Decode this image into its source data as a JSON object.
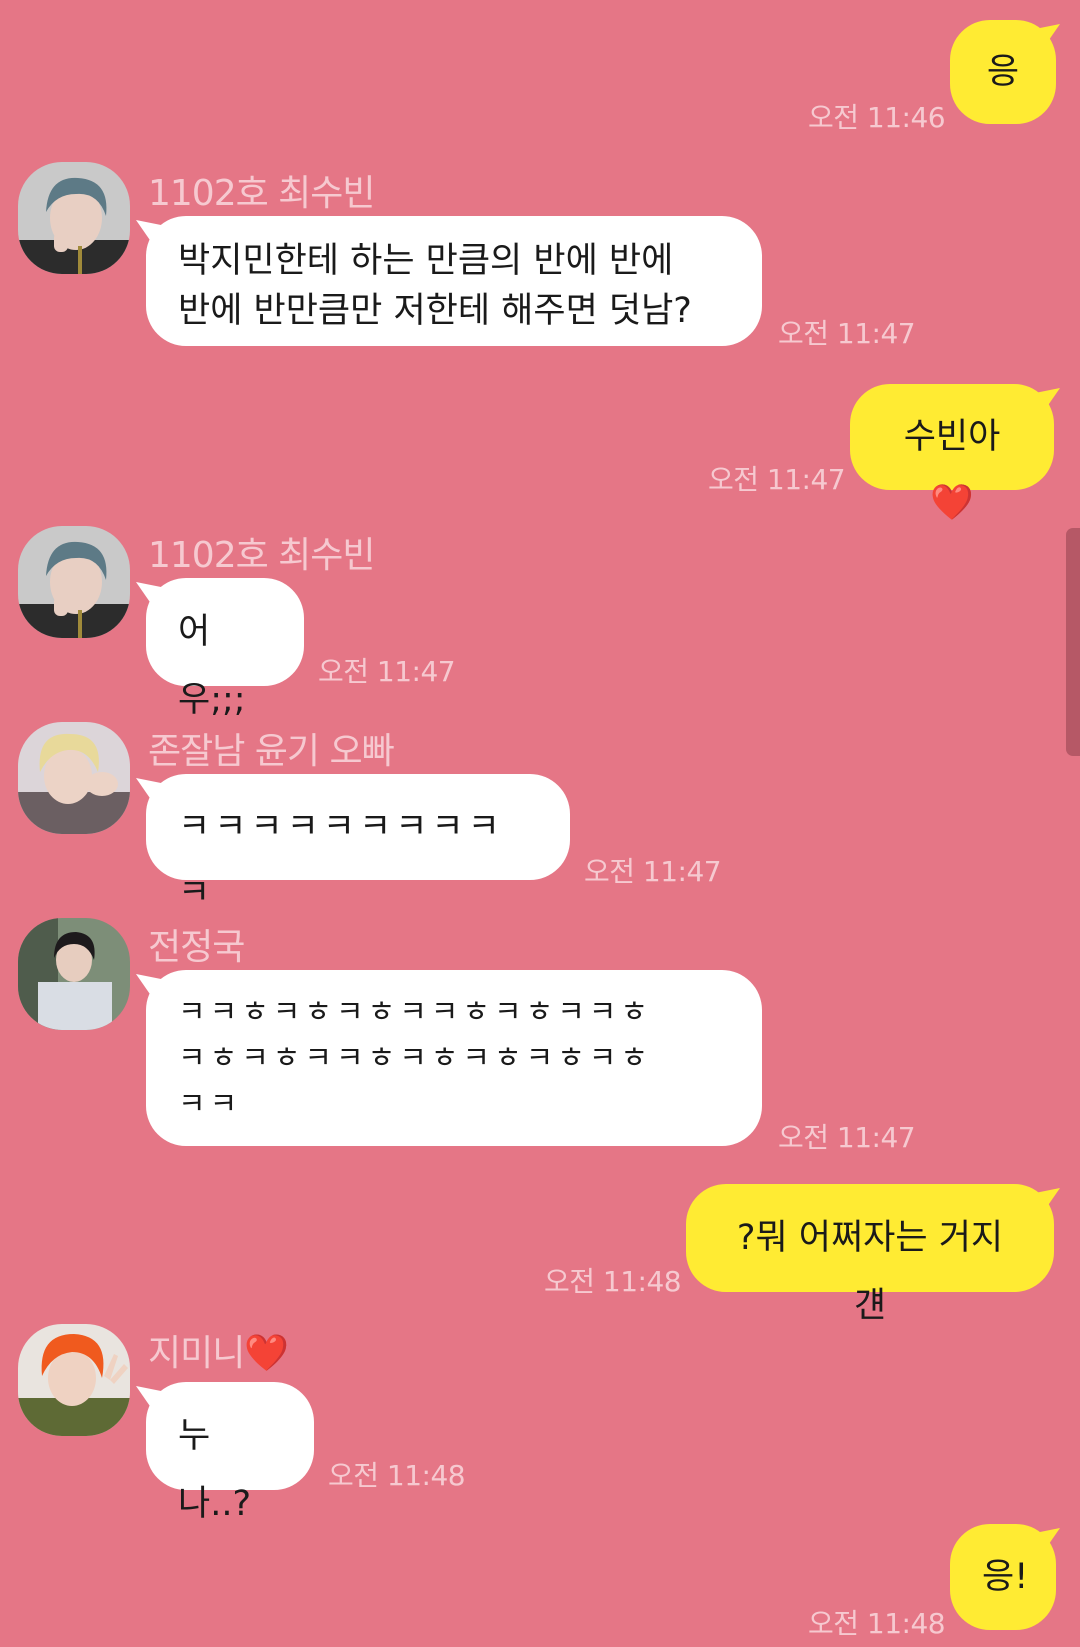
{
  "messages": [
    {
      "side": "out",
      "text": "응",
      "time": "오전 11:46"
    },
    {
      "side": "in",
      "sender": "1102호 최수빈",
      "text": "박지민한테 하는 만큼의 반에 반에\n반에 반만큼만 저한테 해주면 덧남?",
      "time": "오전 11:47"
    },
    {
      "side": "out",
      "text": "수빈아❤️",
      "time": "오전 11:47"
    },
    {
      "side": "in",
      "sender": "1102호 최수빈",
      "text": "어우;;;",
      "time": "오전 11:47"
    },
    {
      "side": "in",
      "sender": "존잘남 윤기 오빠",
      "text": "ㅋㅋㅋㅋㅋㅋㅋㅋㅋㅋ",
      "time": "오전 11:47"
    },
    {
      "side": "in",
      "sender": "전정국",
      "text": "ㅋㅋㅎㅋㅎㅋㅎㅋㅋㅎㅋㅎㅋㅋㅎ\nㅋㅎㅋㅎㅋㅋㅎㅋㅎㅋㅎㅋㅎㅋㅎ\nㅋㅋ",
      "time": "오전 11:47"
    },
    {
      "side": "out",
      "text": "?뭐 어쩌자는 거지 걘",
      "time": "오전 11:48"
    },
    {
      "side": "in",
      "sender": "지미니❤️",
      "text": "누나..?",
      "time": "오전 11:48"
    },
    {
      "side": "out",
      "text": "응!",
      "time": "오전 11:48"
    }
  ],
  "avatars": {
    "soobin": {
      "name": "soobin-avatar",
      "hair": "#5d7a86",
      "skin": "#e8cfc3",
      "bg": "#c9c9c9",
      "cloth": "#2c2c2c"
    },
    "yoongi": {
      "name": "yoongi-avatar",
      "hair": "#e8d99a",
      "skin": "#ecd3c6",
      "bg": "#dcd5d9",
      "cloth": "#6b5f62"
    },
    "jungkook": {
      "name": "jungkook-avatar",
      "hair": "#1d1a1c",
      "skin": "#e7cdbf",
      "bg": "#7d8e78",
      "cloth": "#d9dde4"
    },
    "jimin": {
      "name": "jimin-avatar",
      "hair": "#f05a1e",
      "skin": "#efd2c2",
      "bg": "#e9e4df",
      "cloth": "#5e6a35"
    }
  },
  "colors": {
    "background": "#e57686",
    "incoming_bubble": "#ffffff",
    "outgoing_bubble": "#ffeb33",
    "meta_text": "#f6c9d0"
  }
}
